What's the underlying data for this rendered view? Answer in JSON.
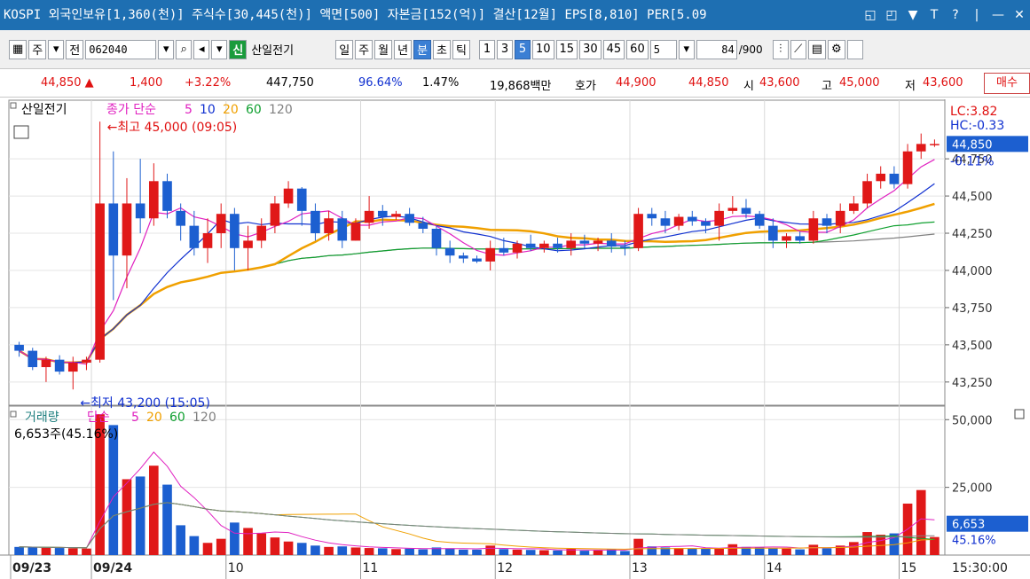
{
  "titlebar": {
    "text": "KOSPI 외국인보유[1,360(천)] 주식수[30,445(천)] 액면[500] 자본금[152(억)] 결산[12월] EPS[8,810] PER[5.09",
    "icons": [
      "restore-icon",
      "link-icon",
      "pin-icon",
      "font-icon",
      "help-icon",
      "minimize-icon",
      "maximize-icon",
      "close-icon"
    ],
    "glyphs": [
      "◱",
      "◰",
      "▼",
      "T",
      "?",
      "|",
      "—",
      "✕"
    ]
  },
  "toolbar": {
    "period_type": "주",
    "market": "전",
    "code": "062040",
    "stock_name": "산일전기",
    "badge": "신",
    "tabs": [
      "일",
      "주",
      "월",
      "년",
      "분",
      "초",
      "틱"
    ],
    "active_tab": "분",
    "intervals": [
      "1",
      "3",
      "5",
      "10",
      "15",
      "30",
      "45",
      "60"
    ],
    "active_interval": "5",
    "custom_interval": "5",
    "count_current": "84",
    "count_total": "/900"
  },
  "quote": {
    "price": "44,850",
    "arrow": "▲",
    "change": "1,400",
    "change_pct": "+3.22%",
    "volume": "447,750",
    "vol_ratio": "96.64%",
    "turnover": "1.47%",
    "amount": "19,868백만",
    "ask_label": "호가",
    "ask": "44,900",
    "bid": "44,850",
    "open_label": "시",
    "open": "43,600",
    "high_label": "고",
    "high": "45,000",
    "low_label": "저",
    "low": "43,600",
    "buy_button": "매수"
  },
  "chart_data": {
    "type": "candlestick",
    "price_legend": {
      "name": "산일전기",
      "ma_label": "종가 단순",
      "periods": [
        "5",
        "10",
        "20",
        "60",
        "120"
      ],
      "colors": [
        "#e020c0",
        "#1030d0",
        "#f0a000",
        "#10a030",
        "#808080"
      ]
    },
    "high_note": "←최고 45,000 (09:05)",
    "low_note": "←최저 43,200 (15:05)",
    "lc": "LC:3.82",
    "hc": "HC:-0.33",
    "current_price_label": "44,850",
    "current_pct_label": "-0.11%",
    "price_ticks": [
      "44,750",
      "44,500",
      "44,250",
      "44,000",
      "43,750",
      "43,500",
      "43,250"
    ],
    "price_tick_values": [
      44750,
      44500,
      44250,
      44000,
      43750,
      43500,
      43250
    ],
    "price_range": [
      43100,
      45150
    ],
    "volume_legend": {
      "name": "거래량",
      "ma_label": "단순",
      "periods": [
        "5",
        "20",
        "60",
        "120"
      ],
      "colors": [
        "#e020c0",
        "#f0a000",
        "#10a030",
        "#808080"
      ]
    },
    "volume_info": "6,653주(45.16%)",
    "volume_ticks": [
      "50,000",
      "25,000"
    ],
    "volume_tick_values": [
      50000,
      25000
    ],
    "volume_range": [
      0,
      55000
    ],
    "current_volume_label": "6,653",
    "current_volume_pct": "45.16%",
    "x_labels": [
      "09/23",
      "09/24",
      "10",
      "11",
      "12",
      "13",
      "14",
      "15"
    ],
    "x_label_slots": [
      0,
      6,
      16,
      26,
      36,
      46,
      56,
      66
    ],
    "time_label": "15:30:00",
    "up_color": "#e01818",
    "down_color": "#1c5fd0",
    "candles": [
      [
        43500,
        43520,
        43420,
        43460,
        3000
      ],
      [
        43460,
        43480,
        43330,
        43350,
        2900
      ],
      [
        43350,
        43420,
        43250,
        43400,
        2700
      ],
      [
        43400,
        43430,
        43300,
        43320,
        2600
      ],
      [
        43320,
        43420,
        43200,
        43380,
        2500
      ],
      [
        43380,
        43420,
        43330,
        43400,
        2400
      ],
      [
        43400,
        45000,
        43380,
        44450,
        52000
      ],
      [
        44450,
        44800,
        43800,
        44100,
        48000
      ],
      [
        44100,
        44620,
        43880,
        44450,
        28000
      ],
      [
        44450,
        44750,
        44250,
        44350,
        29000
      ],
      [
        44350,
        44720,
        44300,
        44600,
        33000
      ],
      [
        44600,
        44650,
        44350,
        44400,
        26000
      ],
      [
        44400,
        44450,
        44200,
        44300,
        11000
      ],
      [
        44300,
        44400,
        44100,
        44150,
        7000
      ],
      [
        44150,
        44350,
        44050,
        44250,
        4500
      ],
      [
        44250,
        44450,
        44150,
        44380,
        6000
      ],
      [
        44380,
        44420,
        44000,
        44150,
        12000
      ],
      [
        44150,
        44300,
        44000,
        44200,
        10000
      ],
      [
        44200,
        44350,
        44150,
        44300,
        8000
      ],
      [
        44300,
        44500,
        44250,
        44450,
        6500
      ],
      [
        44450,
        44600,
        44420,
        44550,
        5000
      ],
      [
        44550,
        44560,
        44300,
        44400,
        4500
      ],
      [
        44400,
        44450,
        44200,
        44250,
        3500
      ],
      [
        44250,
        44400,
        44200,
        44350,
        3000
      ],
      [
        44350,
        44400,
        44150,
        44200,
        3200
      ],
      [
        44200,
        44350,
        44200,
        44320,
        2800
      ],
      [
        44320,
        44500,
        44280,
        44400,
        2600
      ],
      [
        44400,
        44440,
        44300,
        44360,
        2500
      ],
      [
        44360,
        44400,
        44340,
        44380,
        2200
      ],
      [
        44380,
        44420,
        44300,
        44320,
        2400
      ],
      [
        44320,
        44360,
        44250,
        44280,
        2100
      ],
      [
        44280,
        44300,
        44100,
        44150,
        2800
      ],
      [
        44150,
        44200,
        44050,
        44100,
        2500
      ],
      [
        44100,
        44120,
        44050,
        44080,
        2000
      ],
      [
        44080,
        44100,
        44050,
        44060,
        2000
      ],
      [
        44060,
        44200,
        44000,
        44150,
        3500
      ],
      [
        44150,
        44220,
        44100,
        44120,
        2200
      ],
      [
        44120,
        44200,
        44080,
        44180,
        2000
      ],
      [
        44180,
        44240,
        44130,
        44150,
        1900
      ],
      [
        44150,
        44200,
        44120,
        44180,
        1800
      ],
      [
        44180,
        44220,
        44120,
        44150,
        1700
      ],
      [
        44150,
        44250,
        44100,
        44200,
        2300
      ],
      [
        44200,
        44240,
        44150,
        44180,
        1600
      ],
      [
        44180,
        44220,
        44130,
        44200,
        1700
      ],
      [
        44200,
        44250,
        44120,
        44160,
        2100
      ],
      [
        44160,
        44200,
        44100,
        44150,
        1500
      ],
      [
        44150,
        44420,
        44130,
        44380,
        6000
      ],
      [
        44380,
        44420,
        44300,
        44350,
        3200
      ],
      [
        44350,
        44400,
        44250,
        44300,
        2800
      ],
      [
        44300,
        44380,
        44270,
        44360,
        2600
      ],
      [
        44360,
        44400,
        44300,
        44330,
        2500
      ],
      [
        44330,
        44350,
        44250,
        44300,
        2300
      ],
      [
        44300,
        44450,
        44200,
        44400,
        2500
      ],
      [
        44400,
        44500,
        44380,
        44420,
        4000
      ],
      [
        44420,
        44480,
        44350,
        44380,
        3000
      ],
      [
        44380,
        44400,
        44280,
        44300,
        2800
      ],
      [
        44300,
        44350,
        44150,
        44200,
        2600
      ],
      [
        44200,
        44250,
        44150,
        44230,
        2400
      ],
      [
        44230,
        44260,
        44180,
        44200,
        2100
      ],
      [
        44200,
        44400,
        44180,
        44350,
        3800
      ],
      [
        44350,
        44380,
        44250,
        44300,
        2500
      ],
      [
        44300,
        44450,
        44250,
        44400,
        3500
      ],
      [
        44400,
        44500,
        44380,
        44450,
        4800
      ],
      [
        44450,
        44650,
        44420,
        44600,
        8500
      ],
      [
        44600,
        44700,
        44550,
        44650,
        7500
      ],
      [
        44650,
        44700,
        44550,
        44580,
        8000
      ],
      [
        44580,
        44850,
        44550,
        44800,
        19000
      ],
      [
        44800,
        44920,
        44750,
        44850,
        24000
      ],
      [
        44850,
        44880,
        44830,
        44850,
        6653
      ]
    ]
  }
}
